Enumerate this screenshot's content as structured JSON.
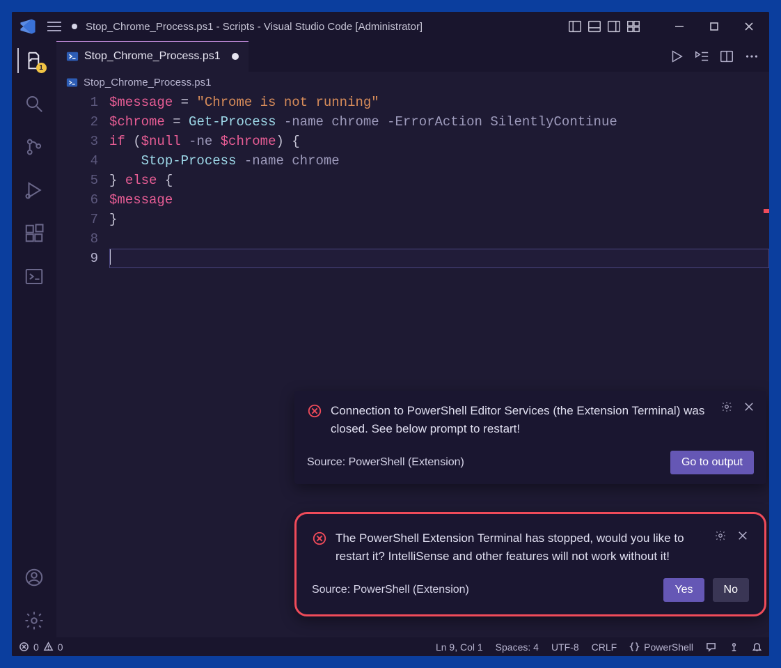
{
  "title": "Stop_Chrome_Process.ps1 - Scripts - Visual Studio Code [Administrator]",
  "tab": {
    "label": "Stop_Chrome_Process.ps1",
    "dirty": true
  },
  "breadcrumb": "Stop_Chrome_Process.ps1",
  "activitybar": {
    "explorer_badge": "1"
  },
  "code": {
    "lines": [
      "1",
      "2",
      "3",
      "4",
      "5",
      "6",
      "7",
      "8",
      "9"
    ],
    "l1": {
      "var": "$message",
      "eq": " = ",
      "str": "\"Chrome is not running\""
    },
    "l2": {
      "var": "$chrome",
      "eq": " = ",
      "cmd": "Get-Process",
      "rest": " -name chrome -ErrorAction SilentlyContinue"
    },
    "l3": {
      "kw_if": "if",
      "open": " (",
      "null": "$null",
      "ne": " -ne ",
      "var": "$chrome",
      "close": ") {"
    },
    "l4": {
      "indent": "    ",
      "cmd": "Stop-Process",
      "rest": " -name chrome"
    },
    "l5": {
      "brace": "} ",
      "kw": "else",
      "open": " {"
    },
    "l6": {
      "var": "$message"
    },
    "l7": {
      "brace": "}"
    }
  },
  "notifications": [
    {
      "id": "n1",
      "message": "Connection to PowerShell Editor Services (the Extension Terminal) was closed. See below prompt to restart!",
      "source": "Source: PowerShell (Extension)",
      "buttons": [
        {
          "label": "Go to output",
          "kind": "primary"
        }
      ],
      "highlight": false
    },
    {
      "id": "n2",
      "message": "The PowerShell Extension Terminal has stopped, would you like to restart it? IntelliSense and other features will not work without it!",
      "source": "Source: PowerShell (Extension)",
      "buttons": [
        {
          "label": "Yes",
          "kind": "primary"
        },
        {
          "label": "No",
          "kind": "secondary"
        }
      ],
      "highlight": true
    }
  ],
  "status": {
    "errors": "0",
    "warnings": "0",
    "position": "Ln 9, Col 1",
    "spaces": "Spaces: 4",
    "encoding": "UTF-8",
    "eol": "CRLF",
    "language": "PowerShell"
  }
}
